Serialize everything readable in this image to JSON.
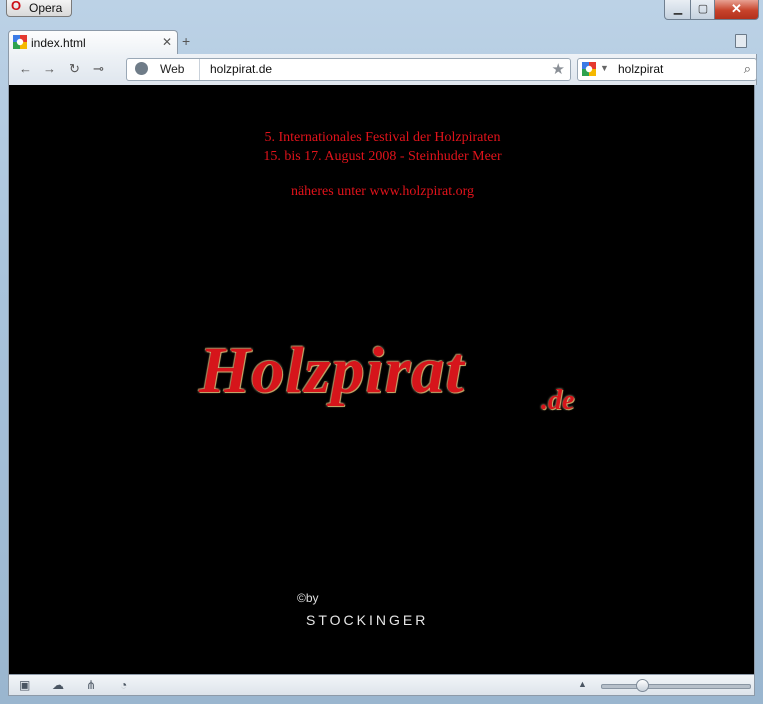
{
  "window": {
    "app_button": "Opera"
  },
  "tab": {
    "title": "index.html"
  },
  "toolbar": {
    "mode_label": "Web",
    "url": "holzpirat.de",
    "search_value": "holzpirat"
  },
  "page": {
    "line1": "5. Internationales Festival der Holzpiraten",
    "line2": "15. bis 17. August 2008 - Steinhuder Meer",
    "line3": "näheres unter www.holzpirat.org",
    "logo": "Holzpirat",
    "logo_tld": ".de",
    "copyright_mark": "©by",
    "credit": "STOCKINGER"
  },
  "colors": {
    "accent_red": "#e1131b",
    "page_bg": "#000000"
  },
  "icons": [
    "opera-logo-icon",
    "minimize-icon",
    "maximize-icon",
    "close-icon",
    "google-favicon-icon",
    "tab-close-icon",
    "new-tab-icon",
    "trash-icon",
    "back-icon",
    "forward-icon",
    "reload-icon",
    "key-icon",
    "globe-icon",
    "star-icon",
    "search-dropdown-icon",
    "magnifier-icon",
    "panel-toggle-icon",
    "cloud-icon",
    "unite-icon",
    "speed-icon",
    "zoom-up-icon"
  ]
}
